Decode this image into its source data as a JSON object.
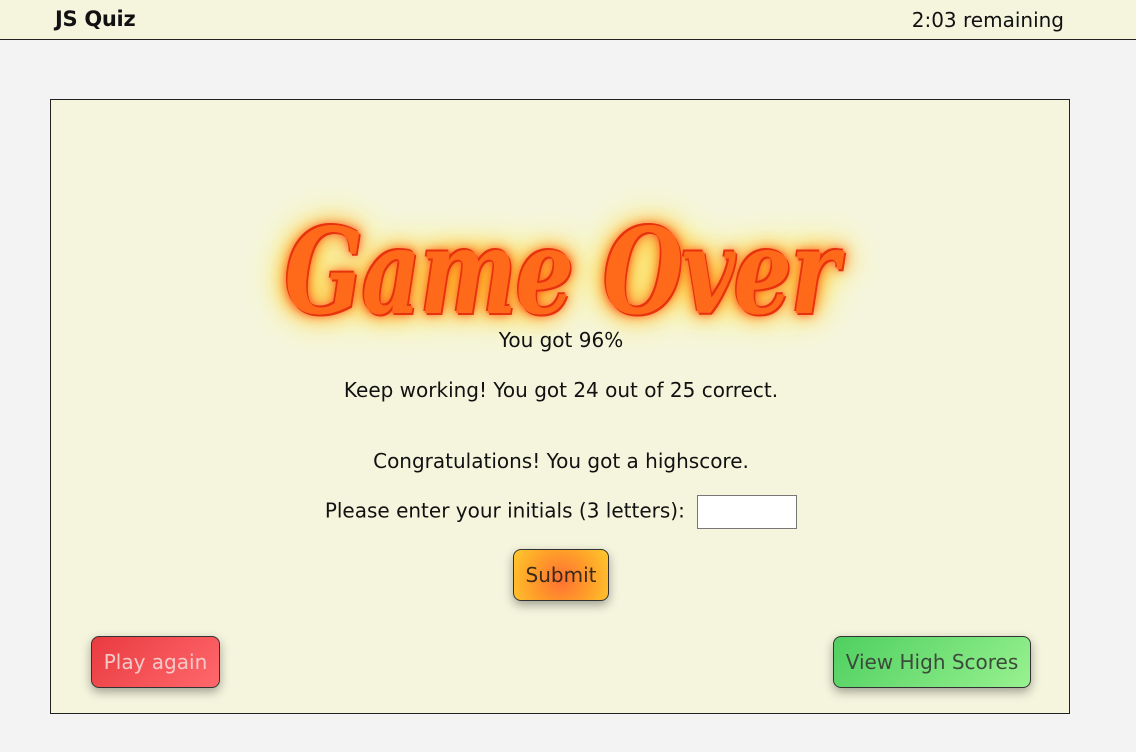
{
  "header": {
    "app_title": "JS Quiz",
    "timer_text": "2:03 remaining"
  },
  "result": {
    "banner": "Game Over",
    "score_line": "You got 96%",
    "feedback_line": "Keep working! You got 24 out of 25 correct.",
    "highscore_line": "Congratulations! You got a highscore.",
    "initials_label": "Please enter your initials (3 letters):",
    "initials_value": "",
    "initials_placeholder": ""
  },
  "buttons": {
    "submit_label": "Submit",
    "play_again_label": "Play again",
    "view_high_scores_label": "View High Scores"
  },
  "colors": {
    "page_background": "#f3f3f3",
    "panel_background": "#f5f5de",
    "banner_fill": "#ff6a1a",
    "banner_glow": "#ffdd00",
    "play_again_red": "#e93b40",
    "high_scores_green": "#4fcf60",
    "submit_orange": "#ffa129"
  }
}
